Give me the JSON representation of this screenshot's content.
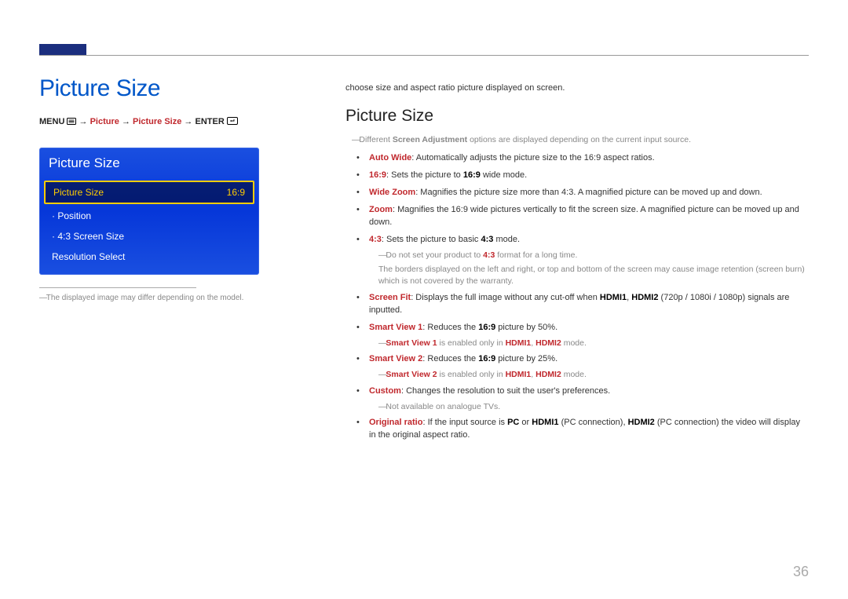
{
  "page_number": "36",
  "main_heading": "Picture Size",
  "breadcrumb": {
    "menu": "MENU",
    "arrow": "→",
    "nav1": "Picture",
    "nav2": "Picture Size",
    "enter": "ENTER"
  },
  "osd": {
    "title": "Picture Size",
    "rows": [
      {
        "label": "Picture Size",
        "value": "16:9",
        "highlight": true,
        "sub": false
      },
      {
        "label": "Position",
        "value": "",
        "highlight": false,
        "sub": true
      },
      {
        "label": "4:3 Screen Size",
        "value": "",
        "highlight": false,
        "sub": true
      },
      {
        "label": "Resolution Select",
        "value": "",
        "highlight": false,
        "sub": false
      }
    ]
  },
  "footnote": "The displayed image may differ depending on the model.",
  "intro": "choose size and aspect ratio picture displayed on screen.",
  "section_heading": "Picture Size",
  "top_note_pre": "Different ",
  "top_note_bold": "Screen Adjustment",
  "top_note_post": " options are displayed depending on the current input source.",
  "items": {
    "auto_wide_k": "Auto Wide",
    "auto_wide_t": ": Automatically adjusts the picture size to the 16:9 aspect ratios.",
    "sixteen_k": "16:9",
    "sixteen_t1": ": Sets the picture to ",
    "sixteen_b": "16:9",
    "sixteen_t2": " wide mode.",
    "wz_k": "Wide Zoom",
    "wz_t": ": Magnifies the picture size more than 4:3. A magnified picture can be moved up and down.",
    "zoom_k": "Zoom",
    "zoom_t": ": Magnifies the 16:9 wide pictures vertically to fit the screen size. A magnified picture can be moved up and down.",
    "four_k": "4:3",
    "four_t1": ": Sets the picture to basic ",
    "four_b": "4:3",
    "four_t2": " mode.",
    "four_note1a": "Do not set your product to ",
    "four_note1b": "4:3",
    "four_note1c": " format for a long time.",
    "four_note2": "The borders displayed on the left and right, or top and bottom of the screen may cause image retention (screen burn) which is not covered by the warranty.",
    "sf_k": "Screen Fit",
    "sf_t1": ": Displays the full image without any cut-off when ",
    "sf_b1": "HDMI1",
    "sf_comma": ", ",
    "sf_b2": "HDMI2",
    "sf_t2": " (720p / 1080i / 1080p) signals are inputted.",
    "sv1_k": "Smart View 1",
    "sv1_t1": ": Reduces the ",
    "sv1_b": "16:9",
    "sv1_t2": " picture by 50%.",
    "sv1_note_a": "Smart View 1",
    "sv1_note_b": " is enabled only in ",
    "sv1_note_c": "HDMI1",
    "sv1_note_d": "HDMI2",
    "sv1_note_e": " mode.",
    "sv2_k": "Smart View 2",
    "sv2_t1": ": Reduces the ",
    "sv2_b": "16:9",
    "sv2_t2": " picture by 25%.",
    "sv2_note_a": "Smart View 2",
    "sv2_note_b": " is enabled only in ",
    "sv2_note_c": "HDMI1",
    "sv2_note_d": "HDMI2",
    "sv2_note_e": " mode.",
    "cust_k": "Custom",
    "cust_t": ": Changes the resolution to suit the user's preferences.",
    "cust_note": "Not available on analogue TVs.",
    "orig_k": "Original ratio",
    "orig_t1": ": If the input source is ",
    "orig_b1": "PC",
    "orig_t2": " or ",
    "orig_b2": "HDMI1",
    "orig_t3": " (PC connection), ",
    "orig_b3": "HDMI2",
    "orig_t4": " (PC connection) the video will display in the original aspect ratio."
  }
}
